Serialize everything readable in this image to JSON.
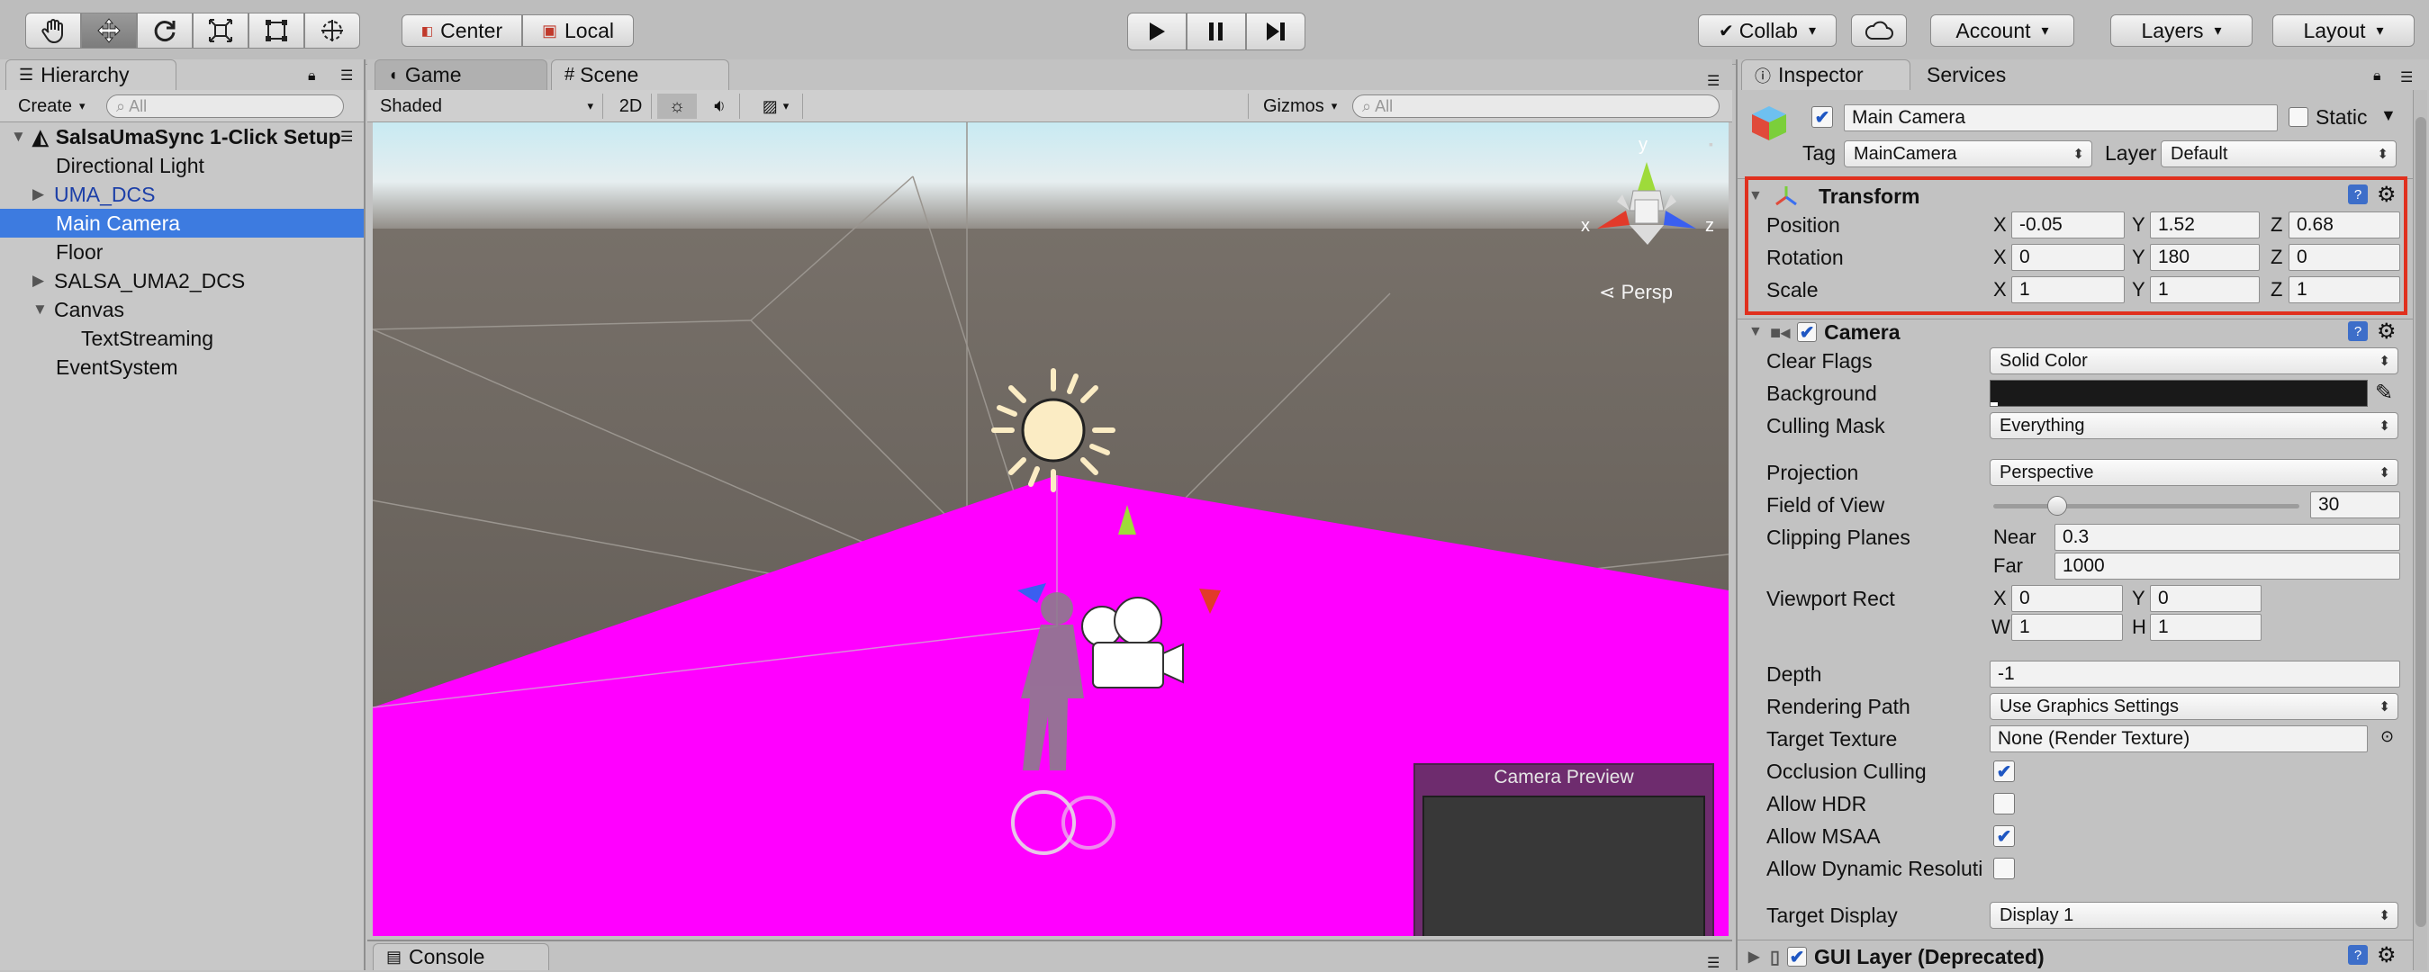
{
  "toolbar": {
    "tools": [
      "hand-tool",
      "move-tool",
      "rotate-tool",
      "scale-tool",
      "rect-tool",
      "transform-tool"
    ],
    "pivot_label": "Center",
    "space_label": "Local",
    "collab_label": "Collab",
    "account_label": "Account",
    "layers_label": "Layers",
    "layout_label": "Layout"
  },
  "hierarchy": {
    "tab_label": "Hierarchy",
    "create_label": "Create",
    "search_placeholder": "All",
    "scene_name": "SalsaUmaSync 1-Click Setup",
    "items": [
      {
        "label": "Directional Light"
      },
      {
        "label": "UMA_DCS"
      },
      {
        "label": "Main Camera"
      },
      {
        "label": "Floor"
      },
      {
        "label": "SALSA_UMA2_DCS"
      },
      {
        "label": "Canvas"
      },
      {
        "label": "TextStreaming"
      },
      {
        "label": "EventSystem"
      }
    ]
  },
  "scene": {
    "tab_game": "Game",
    "tab_scene": "Scene",
    "shading_mode": "Shaded",
    "mode_2d": "2D",
    "gizmos_label": "Gizmos",
    "search_placeholder": "All",
    "persp_label": "Persp",
    "gizmo_axes": {
      "x": "x",
      "y": "y",
      "z": "z"
    },
    "camera_preview_title": "Camera Preview"
  },
  "console": {
    "tab_label": "Console"
  },
  "inspector": {
    "tab_label": "Inspector",
    "services_label": "Services",
    "object_name": "Main Camera",
    "static_label": "Static",
    "tag_label": "Tag",
    "tag_value": "MainCamera",
    "layer_label": "Layer",
    "layer_value": "Default",
    "transform": {
      "title": "Transform",
      "position_label": "Position",
      "rotation_label": "Rotation",
      "scale_label": "Scale",
      "position": {
        "x": "-0.05",
        "y": "1.52",
        "z": "0.68"
      },
      "rotation": {
        "x": "0",
        "y": "180",
        "z": "0"
      },
      "scale": {
        "x": "1",
        "y": "1",
        "z": "1"
      }
    },
    "camera": {
      "title": "Camera",
      "clear_flags_label": "Clear Flags",
      "clear_flags": "Solid Color",
      "background_label": "Background",
      "culling_mask_label": "Culling Mask",
      "culling_mask": "Everything",
      "projection_label": "Projection",
      "projection": "Perspective",
      "fov_label": "Field of View",
      "fov": "30",
      "fov_fraction": 0.19,
      "clipping_label": "Clipping Planes",
      "near_label": "Near",
      "near": "0.3",
      "far_label": "Far",
      "far": "1000",
      "viewport_label": "Viewport Rect",
      "vp": {
        "x": "0",
        "y": "0",
        "w": "1",
        "h": "1"
      },
      "depth_label": "Depth",
      "depth": "-1",
      "rendering_path_label": "Rendering Path",
      "rendering_path": "Use Graphics Settings",
      "target_texture_label": "Target Texture",
      "target_texture": "None (Render Texture)",
      "occlusion_label": "Occlusion Culling",
      "hdr_label": "Allow HDR",
      "msaa_label": "Allow MSAA",
      "dynres_label": "Allow Dynamic Resoluti",
      "target_display_label": "Target Display",
      "target_display": "Display 1"
    },
    "gui_layer": {
      "title": "GUI Layer (Deprecated)"
    }
  },
  "axis_letters": {
    "x": "X",
    "y": "Y",
    "z": "Z",
    "w": "W",
    "h": "H"
  },
  "colors": {
    "selection": "#3d7be0",
    "magenta_floor": "#ff00ff",
    "highlight_box": "#e0301e"
  }
}
